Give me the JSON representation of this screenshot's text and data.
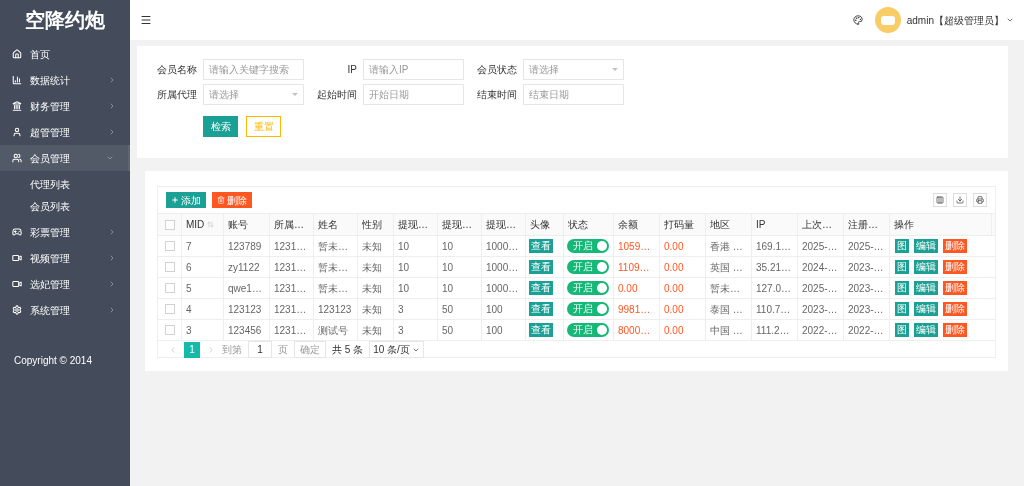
{
  "sidebar": {
    "logo": "空降约炮",
    "items": [
      {
        "label": "首页"
      },
      {
        "label": "数据统计",
        "expanded": false
      },
      {
        "label": "财务管理",
        "expanded": false
      },
      {
        "label": "超管管理",
        "expanded": false
      },
      {
        "label": "会员管理",
        "expanded": true,
        "children": [
          {
            "label": "代理列表"
          },
          {
            "label": "会员列表"
          }
        ]
      },
      {
        "label": "彩票管理",
        "expanded": false
      },
      {
        "label": "视频管理",
        "expanded": false
      },
      {
        "label": "选妃管理",
        "expanded": false
      },
      {
        "label": "系统管理",
        "expanded": false
      }
    ],
    "copyright": "Copyright © 2014"
  },
  "header": {
    "user": "admin【超级管理员】"
  },
  "search_form": {
    "fields": [
      {
        "label": "会员名称",
        "placeholder": "请输入关键字搜索",
        "kind": "input"
      },
      {
        "label": "IP",
        "placeholder": "请输入IP",
        "kind": "input"
      },
      {
        "label": "会员状态",
        "placeholder": "请选择",
        "kind": "select"
      },
      {
        "label": "所属代理",
        "placeholder": "请选择",
        "kind": "select"
      },
      {
        "label": "起始时间",
        "placeholder": "开始日期",
        "kind": "input"
      },
      {
        "label": "结束时间",
        "placeholder": "结束日期",
        "kind": "input"
      }
    ],
    "search_button": "检索",
    "reset_button": "重置"
  },
  "table": {
    "add_button": "添加",
    "delete_button": "删除",
    "header_checked": false,
    "columns": [
      "MID",
      "账号",
      "所属…",
      "姓名",
      "性别",
      "提现…",
      "提现…",
      "提现…",
      "头像",
      "状态",
      "余额",
      "打码量",
      "地区",
      "IP",
      "上次…",
      "注册…",
      "操作"
    ],
    "rows": [
      {
        "checked": false,
        "cells": [
          "7",
          "123789",
          "1231…",
          "暂未…",
          "未知",
          "10",
          "10",
          "1000…"
        ],
        "avatar": "查看",
        "status": {
          "label": "开启",
          "on": true
        },
        "balance": "1059…",
        "bet": "0.00",
        "tail": [
          "香港 …",
          "169.1…",
          "2025-…",
          "2025-…"
        ],
        "actions": [
          "图",
          "编辑",
          "删除"
        ]
      },
      {
        "checked": false,
        "cells": [
          "6",
          "zy1122",
          "1231…",
          "暂未…",
          "未知",
          "10",
          "10",
          "1000…"
        ],
        "avatar": "查看",
        "status": {
          "label": "开启",
          "on": true
        },
        "balance": "1109…",
        "bet": "0.00",
        "tail": [
          "英国 …",
          "35.21…",
          "2024-…",
          "2023-…"
        ],
        "actions": [
          "图",
          "编辑",
          "删除"
        ]
      },
      {
        "checked": false,
        "cells": [
          "5",
          "qwe1…",
          "1231…",
          "暂未…",
          "未知",
          "10",
          "10",
          "1000…"
        ],
        "avatar": "查看",
        "status": {
          "label": "开启",
          "on": true
        },
        "balance": "0.00",
        "bet": "0.00",
        "tail": [
          "暂未…",
          "127.0…",
          "2025-…",
          "2023-…"
        ],
        "actions": [
          "图",
          "编辑",
          "删除"
        ]
      },
      {
        "checked": false,
        "cells": [
          "4",
          "123123",
          "1231…",
          "123123",
          "未知",
          "3",
          "50",
          "100"
        ],
        "avatar": "查看",
        "status": {
          "label": "开启",
          "on": true
        },
        "balance": "9981…",
        "bet": "0.00",
        "tail": [
          "泰国 …",
          "110.7…",
          "2023-…",
          "2023-…"
        ],
        "actions": [
          "图",
          "编辑",
          "删除"
        ]
      },
      {
        "checked": false,
        "cells": [
          "3",
          "123456",
          "1231…",
          "测试号",
          "未知",
          "3",
          "50",
          "100"
        ],
        "avatar": "查看",
        "status": {
          "label": "开启",
          "on": true
        },
        "balance": "8000…",
        "bet": "0.00",
        "tail": [
          "中国 …",
          "111.2…",
          "2022-…",
          "2022-…"
        ],
        "actions": [
          "图",
          "编辑",
          "删除"
        ]
      }
    ],
    "pagination": {
      "pages": [
        {
          "label": "1",
          "selected": true
        }
      ],
      "goto_label": "到第",
      "goto_value": "1",
      "page_unit": "页",
      "confirm": "确定",
      "total": "共 5 条",
      "page_size": "10 条/页"
    }
  }
}
